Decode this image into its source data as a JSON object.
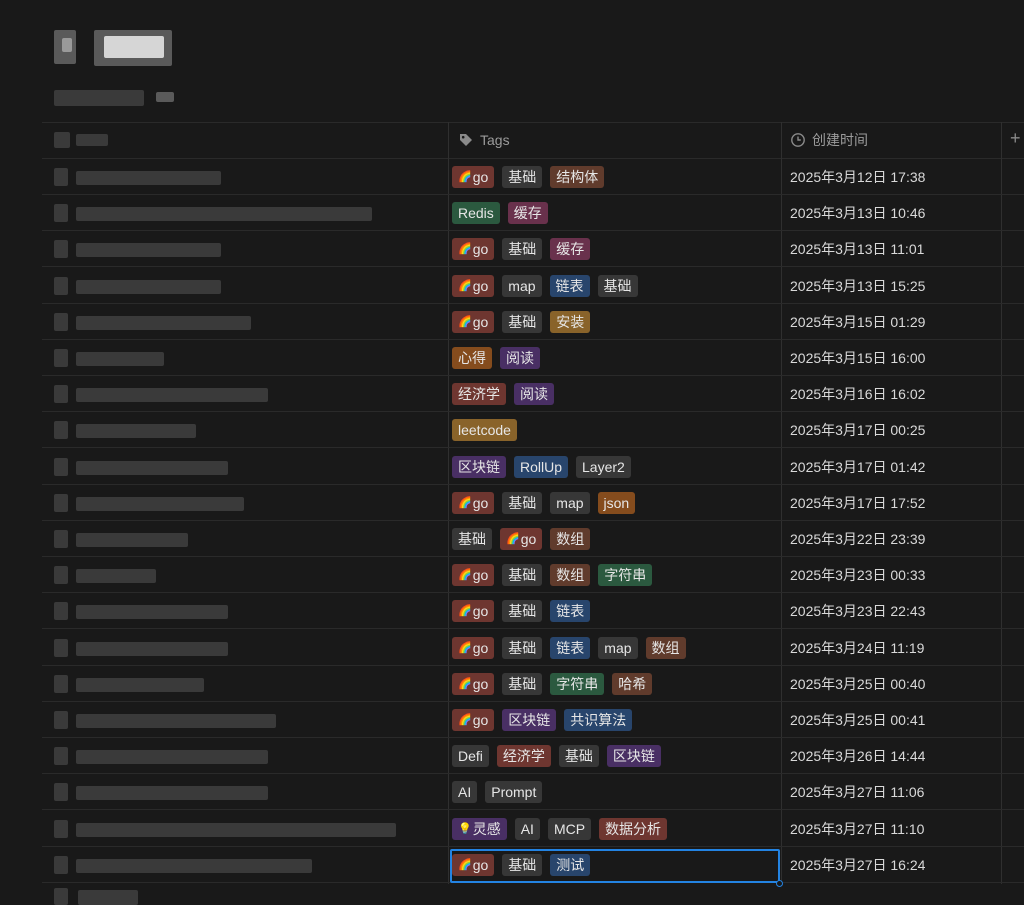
{
  "columns": {
    "tags_label": "Tags",
    "created_label": "创建时间",
    "add_icon": "plus-icon"
  },
  "rows": [
    {
      "tags": [
        {
          "text": "go",
          "emoji": "🌈",
          "color": "red"
        },
        {
          "text": "基础",
          "color": "gray"
        },
        {
          "text": "结构体",
          "color": "brown"
        }
      ],
      "created": "2025年3月12日 17:38"
    },
    {
      "tags": [
        {
          "text": "Redis",
          "color": "green"
        },
        {
          "text": "缓存",
          "color": "pink"
        }
      ],
      "created": "2025年3月13日 10:46"
    },
    {
      "tags": [
        {
          "text": "go",
          "emoji": "🌈",
          "color": "red"
        },
        {
          "text": "基础",
          "color": "gray"
        },
        {
          "text": "缓存",
          "color": "pink"
        }
      ],
      "created": "2025年3月13日 11:01"
    },
    {
      "tags": [
        {
          "text": "go",
          "emoji": "🌈",
          "color": "red"
        },
        {
          "text": "map",
          "color": "gray"
        },
        {
          "text": "链表",
          "color": "blue"
        },
        {
          "text": "基础",
          "color": "gray"
        }
      ],
      "created": "2025年3月13日 15:25"
    },
    {
      "tags": [
        {
          "text": "go",
          "emoji": "🌈",
          "color": "red"
        },
        {
          "text": "基础",
          "color": "gray"
        },
        {
          "text": "安装",
          "color": "yellow"
        }
      ],
      "created": "2025年3月15日 01:29"
    },
    {
      "tags": [
        {
          "text": "心得",
          "color": "orange"
        },
        {
          "text": "阅读",
          "color": "purple"
        }
      ],
      "created": "2025年3月15日 16:00"
    },
    {
      "tags": [
        {
          "text": "经济学",
          "color": "red"
        },
        {
          "text": "阅读",
          "color": "purple"
        }
      ],
      "created": "2025年3月16日 16:02"
    },
    {
      "tags": [
        {
          "text": "leetcode",
          "color": "yellow"
        }
      ],
      "created": "2025年3月17日 00:25"
    },
    {
      "tags": [
        {
          "text": "区块链",
          "color": "purple"
        },
        {
          "text": "RollUp",
          "color": "blue"
        },
        {
          "text": "Layer2",
          "color": "gray"
        }
      ],
      "created": "2025年3月17日 01:42"
    },
    {
      "tags": [
        {
          "text": "go",
          "emoji": "🌈",
          "color": "red"
        },
        {
          "text": "基础",
          "color": "gray"
        },
        {
          "text": "map",
          "color": "gray"
        },
        {
          "text": "json",
          "color": "orange"
        }
      ],
      "created": "2025年3月17日 17:52"
    },
    {
      "tags": [
        {
          "text": "基础",
          "color": "gray"
        },
        {
          "text": "go",
          "emoji": "🌈",
          "color": "red"
        },
        {
          "text": "数组",
          "color": "brown"
        }
      ],
      "created": "2025年3月22日 23:39"
    },
    {
      "tags": [
        {
          "text": "go",
          "emoji": "🌈",
          "color": "red"
        },
        {
          "text": "基础",
          "color": "gray"
        },
        {
          "text": "数组",
          "color": "brown"
        },
        {
          "text": "字符串",
          "color": "green"
        }
      ],
      "created": "2025年3月23日 00:33"
    },
    {
      "tags": [
        {
          "text": "go",
          "emoji": "🌈",
          "color": "red"
        },
        {
          "text": "基础",
          "color": "gray"
        },
        {
          "text": "链表",
          "color": "blue"
        }
      ],
      "created": "2025年3月23日 22:43"
    },
    {
      "tags": [
        {
          "text": "go",
          "emoji": "🌈",
          "color": "red"
        },
        {
          "text": "基础",
          "color": "gray"
        },
        {
          "text": "链表",
          "color": "blue"
        },
        {
          "text": "map",
          "color": "gray"
        },
        {
          "text": "数组",
          "color": "brown"
        }
      ],
      "created": "2025年3月24日 11:19"
    },
    {
      "tags": [
        {
          "text": "go",
          "emoji": "🌈",
          "color": "red"
        },
        {
          "text": "基础",
          "color": "gray"
        },
        {
          "text": "字符串",
          "color": "green"
        },
        {
          "text": "哈希",
          "color": "brown"
        }
      ],
      "created": "2025年3月25日 00:40"
    },
    {
      "tags": [
        {
          "text": "go",
          "emoji": "🌈",
          "color": "red"
        },
        {
          "text": "区块链",
          "color": "purple"
        },
        {
          "text": "共识算法",
          "color": "blue"
        }
      ],
      "created": "2025年3月25日 00:41"
    },
    {
      "tags": [
        {
          "text": "Defi",
          "color": "gray"
        },
        {
          "text": "经济学",
          "color": "red"
        },
        {
          "text": "基础",
          "color": "gray"
        },
        {
          "text": "区块链",
          "color": "purple"
        }
      ],
      "created": "2025年3月26日 14:44"
    },
    {
      "tags": [
        {
          "text": "AI",
          "color": "gray"
        },
        {
          "text": "Prompt",
          "color": "gray"
        }
      ],
      "created": "2025年3月27日 11:06"
    },
    {
      "tags": [
        {
          "text": "灵感",
          "emoji": "💡",
          "color": "purple"
        },
        {
          "text": "AI",
          "color": "gray"
        },
        {
          "text": "MCP",
          "color": "gray"
        },
        {
          "text": "数据分析",
          "color": "red"
        }
      ],
      "created": "2025年3月27日 11:10"
    },
    {
      "tags": [
        {
          "text": "go",
          "emoji": "🌈",
          "color": "red"
        },
        {
          "text": "基础",
          "color": "gray"
        },
        {
          "text": "测试",
          "color": "blue"
        }
      ],
      "created": "2025年3月27日 16:24"
    }
  ]
}
